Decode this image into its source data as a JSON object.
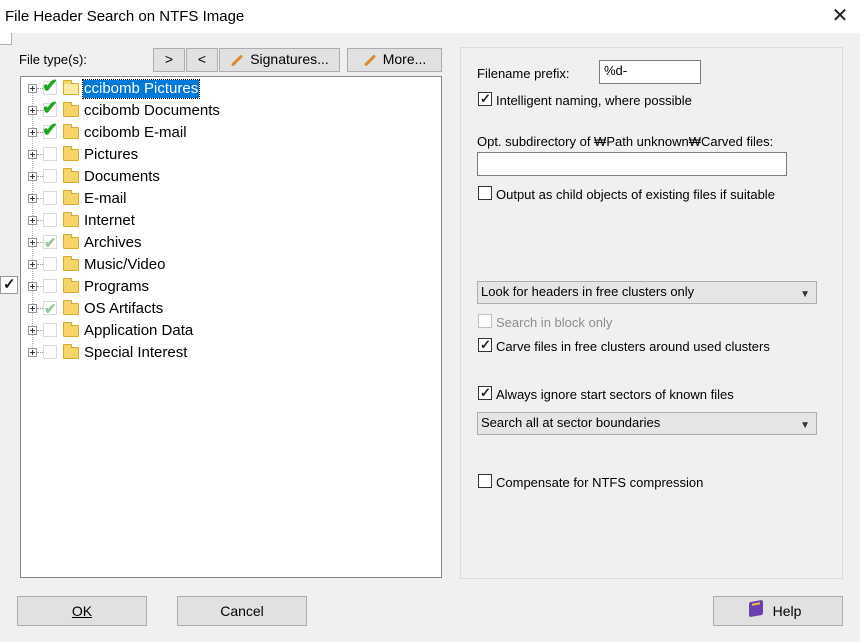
{
  "window": {
    "title": "File Header Search on NTFS Image",
    "close_glyph": "✕"
  },
  "left": {
    "filetypes_label": "File type(s):",
    "btn_expand": ">",
    "btn_collapse": "<",
    "btn_signatures": "Signatures...",
    "btn_more": "More...",
    "tree": [
      {
        "label": "ccibomb Pictures",
        "state": "checked",
        "selected": true
      },
      {
        "label": "ccibomb Documents",
        "state": "checked",
        "selected": false
      },
      {
        "label": "ccibomb E-mail",
        "state": "checked",
        "selected": false
      },
      {
        "label": "Pictures",
        "state": "unchecked",
        "selected": false
      },
      {
        "label": "Documents",
        "state": "unchecked",
        "selected": false
      },
      {
        "label": "E-mail",
        "state": "unchecked",
        "selected": false
      },
      {
        "label": "Internet",
        "state": "unchecked",
        "selected": false
      },
      {
        "label": "Archives",
        "state": "partial",
        "selected": false
      },
      {
        "label": "Music/Video",
        "state": "unchecked",
        "selected": false
      },
      {
        "label": "Programs",
        "state": "unchecked",
        "selected": false
      },
      {
        "label": "OS Artifacts",
        "state": "partial",
        "selected": false
      },
      {
        "label": "Application Data",
        "state": "unchecked",
        "selected": false
      },
      {
        "label": "Special Interest",
        "state": "unchecked",
        "selected": false
      }
    ]
  },
  "right": {
    "prefix_label": "Filename prefix:",
    "prefix_value": "%d-",
    "intelligent_naming": {
      "label": "Intelligent naming, where possible",
      "checked": true
    },
    "subdir_label": "Opt. subdirectory of ₩Path unknown₩Carved files:",
    "subdir_value": "",
    "child_objects": {
      "label": "Output as child objects of existing files if suitable",
      "checked": false
    },
    "look_for_select": "Look for headers in free clusters only",
    "search_block": {
      "label": "Search in block only",
      "checked": false,
      "disabled": true
    },
    "carve_free": {
      "label": "Carve files in free clusters around used clusters",
      "checked": true
    },
    "ignore_start": {
      "label": "Always ignore start sectors of known files",
      "checked": true
    },
    "search_all_select": "Search all at sector boundaries",
    "compensate": {
      "label": "Compensate for NTFS compression",
      "checked": false
    }
  },
  "footer": {
    "ok": "OK",
    "cancel": "Cancel",
    "help": "Help"
  }
}
